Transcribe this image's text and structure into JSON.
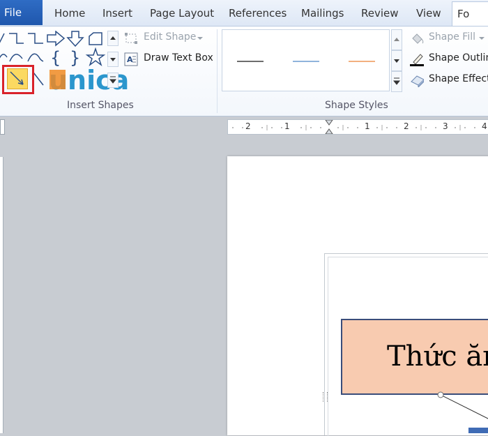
{
  "tabs": {
    "file": "File",
    "home": "Home",
    "insert": "Insert",
    "page_layout": "Page Layout",
    "references": "References",
    "mailings": "Mailings",
    "review": "Review",
    "view": "View",
    "format": "Fo"
  },
  "insert_shapes": {
    "label": "Insert Shapes",
    "edit_shape": "Edit Shape",
    "draw_text_box": "Draw Text Box"
  },
  "shape_styles": {
    "label": "Shape Styles",
    "shape_fill": "Shape Fill",
    "shape_outline": "Shape Outlin",
    "shape_effects": "Shape Effect",
    "style_colors": [
      "#6d6d6d",
      "#8fb4dc",
      "#f3b07f"
    ]
  },
  "watermark": "unica",
  "ruler": {
    "labels": [
      "2",
      "1",
      "1",
      "2",
      "3",
      "4"
    ]
  },
  "document": {
    "box_text": "Thức ăn"
  },
  "colors": {
    "file_tab": "#2462b8",
    "highlight": "#d9222a",
    "box_fill": "#f8cbb0",
    "box_border": "#3a4d7a"
  }
}
